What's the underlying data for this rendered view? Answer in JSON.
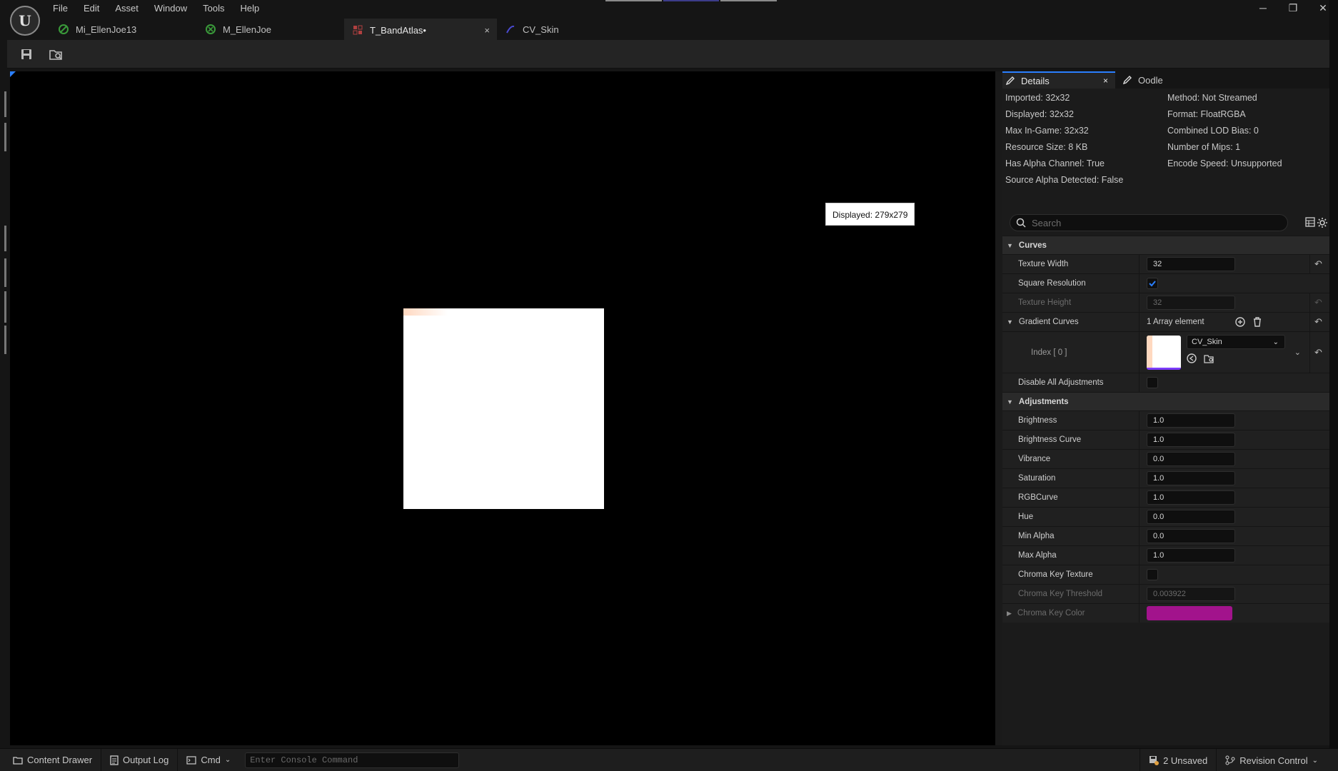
{
  "app": {
    "menu": [
      "File",
      "Edit",
      "Asset",
      "Window",
      "Tools",
      "Help"
    ],
    "window_controls": {
      "minimize": "─",
      "restore": "❐",
      "close": "✕"
    }
  },
  "tabs": [
    {
      "label": "Mi_EllenJoe13",
      "icon": "material-instance-icon",
      "color": "#3a9a3a",
      "active": false
    },
    {
      "label": "M_EllenJoe",
      "icon": "material-icon",
      "color": "#3a9a3a",
      "active": false
    },
    {
      "label": "T_BandAtlas•",
      "icon": "texture-icon",
      "color": "#b04040",
      "active": true,
      "close": "×"
    },
    {
      "label": "CV_Skin",
      "icon": "curve-icon",
      "color": "#3a3aaa",
      "active": false
    }
  ],
  "toolbar": {
    "save_icon": "save-icon",
    "browse_icon": "browse-to-asset-icon"
  },
  "viewport": {
    "tooltip": "Displayed: 279x279"
  },
  "details": {
    "tab_label": "Details",
    "tab_close": "×",
    "tab2_label": "Oodle",
    "info_left": [
      "Imported: 32x32",
      "Displayed: 32x32",
      "Max In-Game: 32x32",
      "Resource Size: 8 KB",
      "Has Alpha Channel: True",
      "Source Alpha Detected: False"
    ],
    "info_right": [
      "Method: Not Streamed",
      "Format: FloatRGBA",
      "Combined LOD Bias: 0",
      "Number of Mips: 1",
      "Encode Speed: Unsupported"
    ],
    "search_placeholder": "Search",
    "curves": {
      "header": "Curves",
      "texture_width_label": "Texture Width",
      "texture_width": "32",
      "square_resolution_label": "Square Resolution",
      "square_resolution": true,
      "texture_height_label": "Texture Height",
      "texture_height": "32",
      "gradient_curves_label": "Gradient Curves",
      "gradient_curves_count": "1 Array element",
      "index_label": "Index [ 0 ]",
      "index_asset": "CV_Skin",
      "disable_all_label": "Disable All Adjustments",
      "disable_all": false
    },
    "adjustments": {
      "header": "Adjustments",
      "rows": [
        {
          "label": "Brightness",
          "value": "1.0"
        },
        {
          "label": "Brightness Curve",
          "value": "1.0"
        },
        {
          "label": "Vibrance",
          "value": "0.0"
        },
        {
          "label": "Saturation",
          "value": "1.0"
        },
        {
          "label": "RGBCurve",
          "value": "1.0"
        },
        {
          "label": "Hue",
          "value": "0.0"
        },
        {
          "label": "Min Alpha",
          "value": "0.0"
        },
        {
          "label": "Max Alpha",
          "value": "1.0"
        }
      ],
      "chroma_key_texture_label": "Chroma Key Texture",
      "chroma_key_texture": false,
      "chroma_key_threshold_label": "Chroma Key Threshold",
      "chroma_key_threshold": "0.003922",
      "chroma_key_color_label": "Chroma Key Color",
      "chroma_key_color": "#a2138c"
    }
  },
  "statusbar": {
    "content_drawer": "Content Drawer",
    "output_log": "Output Log",
    "cmd": "Cmd",
    "console_placeholder": "Enter Console Command",
    "unsaved": "2 Unsaved",
    "revision_control": "Revision Control"
  }
}
